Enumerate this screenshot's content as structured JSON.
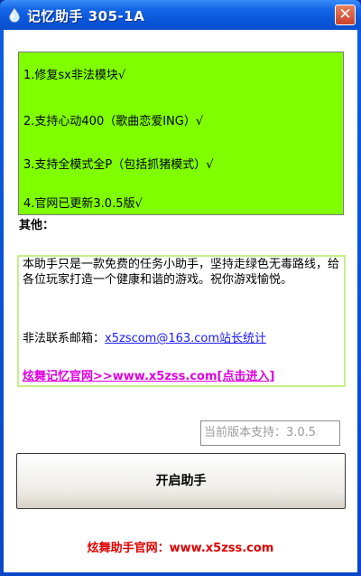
{
  "window": {
    "title": "记忆助手 305-1A",
    "close_label": "✕"
  },
  "updates": [
    "1.修复sx非法模块√",
    "2.支持心动400（歌曲恋爱ING）√",
    "3.支持全模式全P（包括抓猪模式）√",
    "4.官网已更新3.0.5版√"
  ],
  "other": {
    "label": "其他：",
    "description": "本助手只是一款免费的任务小助手，坚持走绿色无毒路线，给各位玩家打造一个健康和谐的游戏。祝你游戏愉悦。",
    "email_label": "非法联系邮箱：",
    "email_link": "x5zscom@163.com站长统计",
    "site_link": "炫舞记忆官网>>www.x5zss.com[点击进入]"
  },
  "version": {
    "text": "当前版本支持：3.0.5"
  },
  "start_button": {
    "label": "开启助手"
  },
  "footer": {
    "text": "炫舞助手官网：www.x5zss.com"
  }
}
